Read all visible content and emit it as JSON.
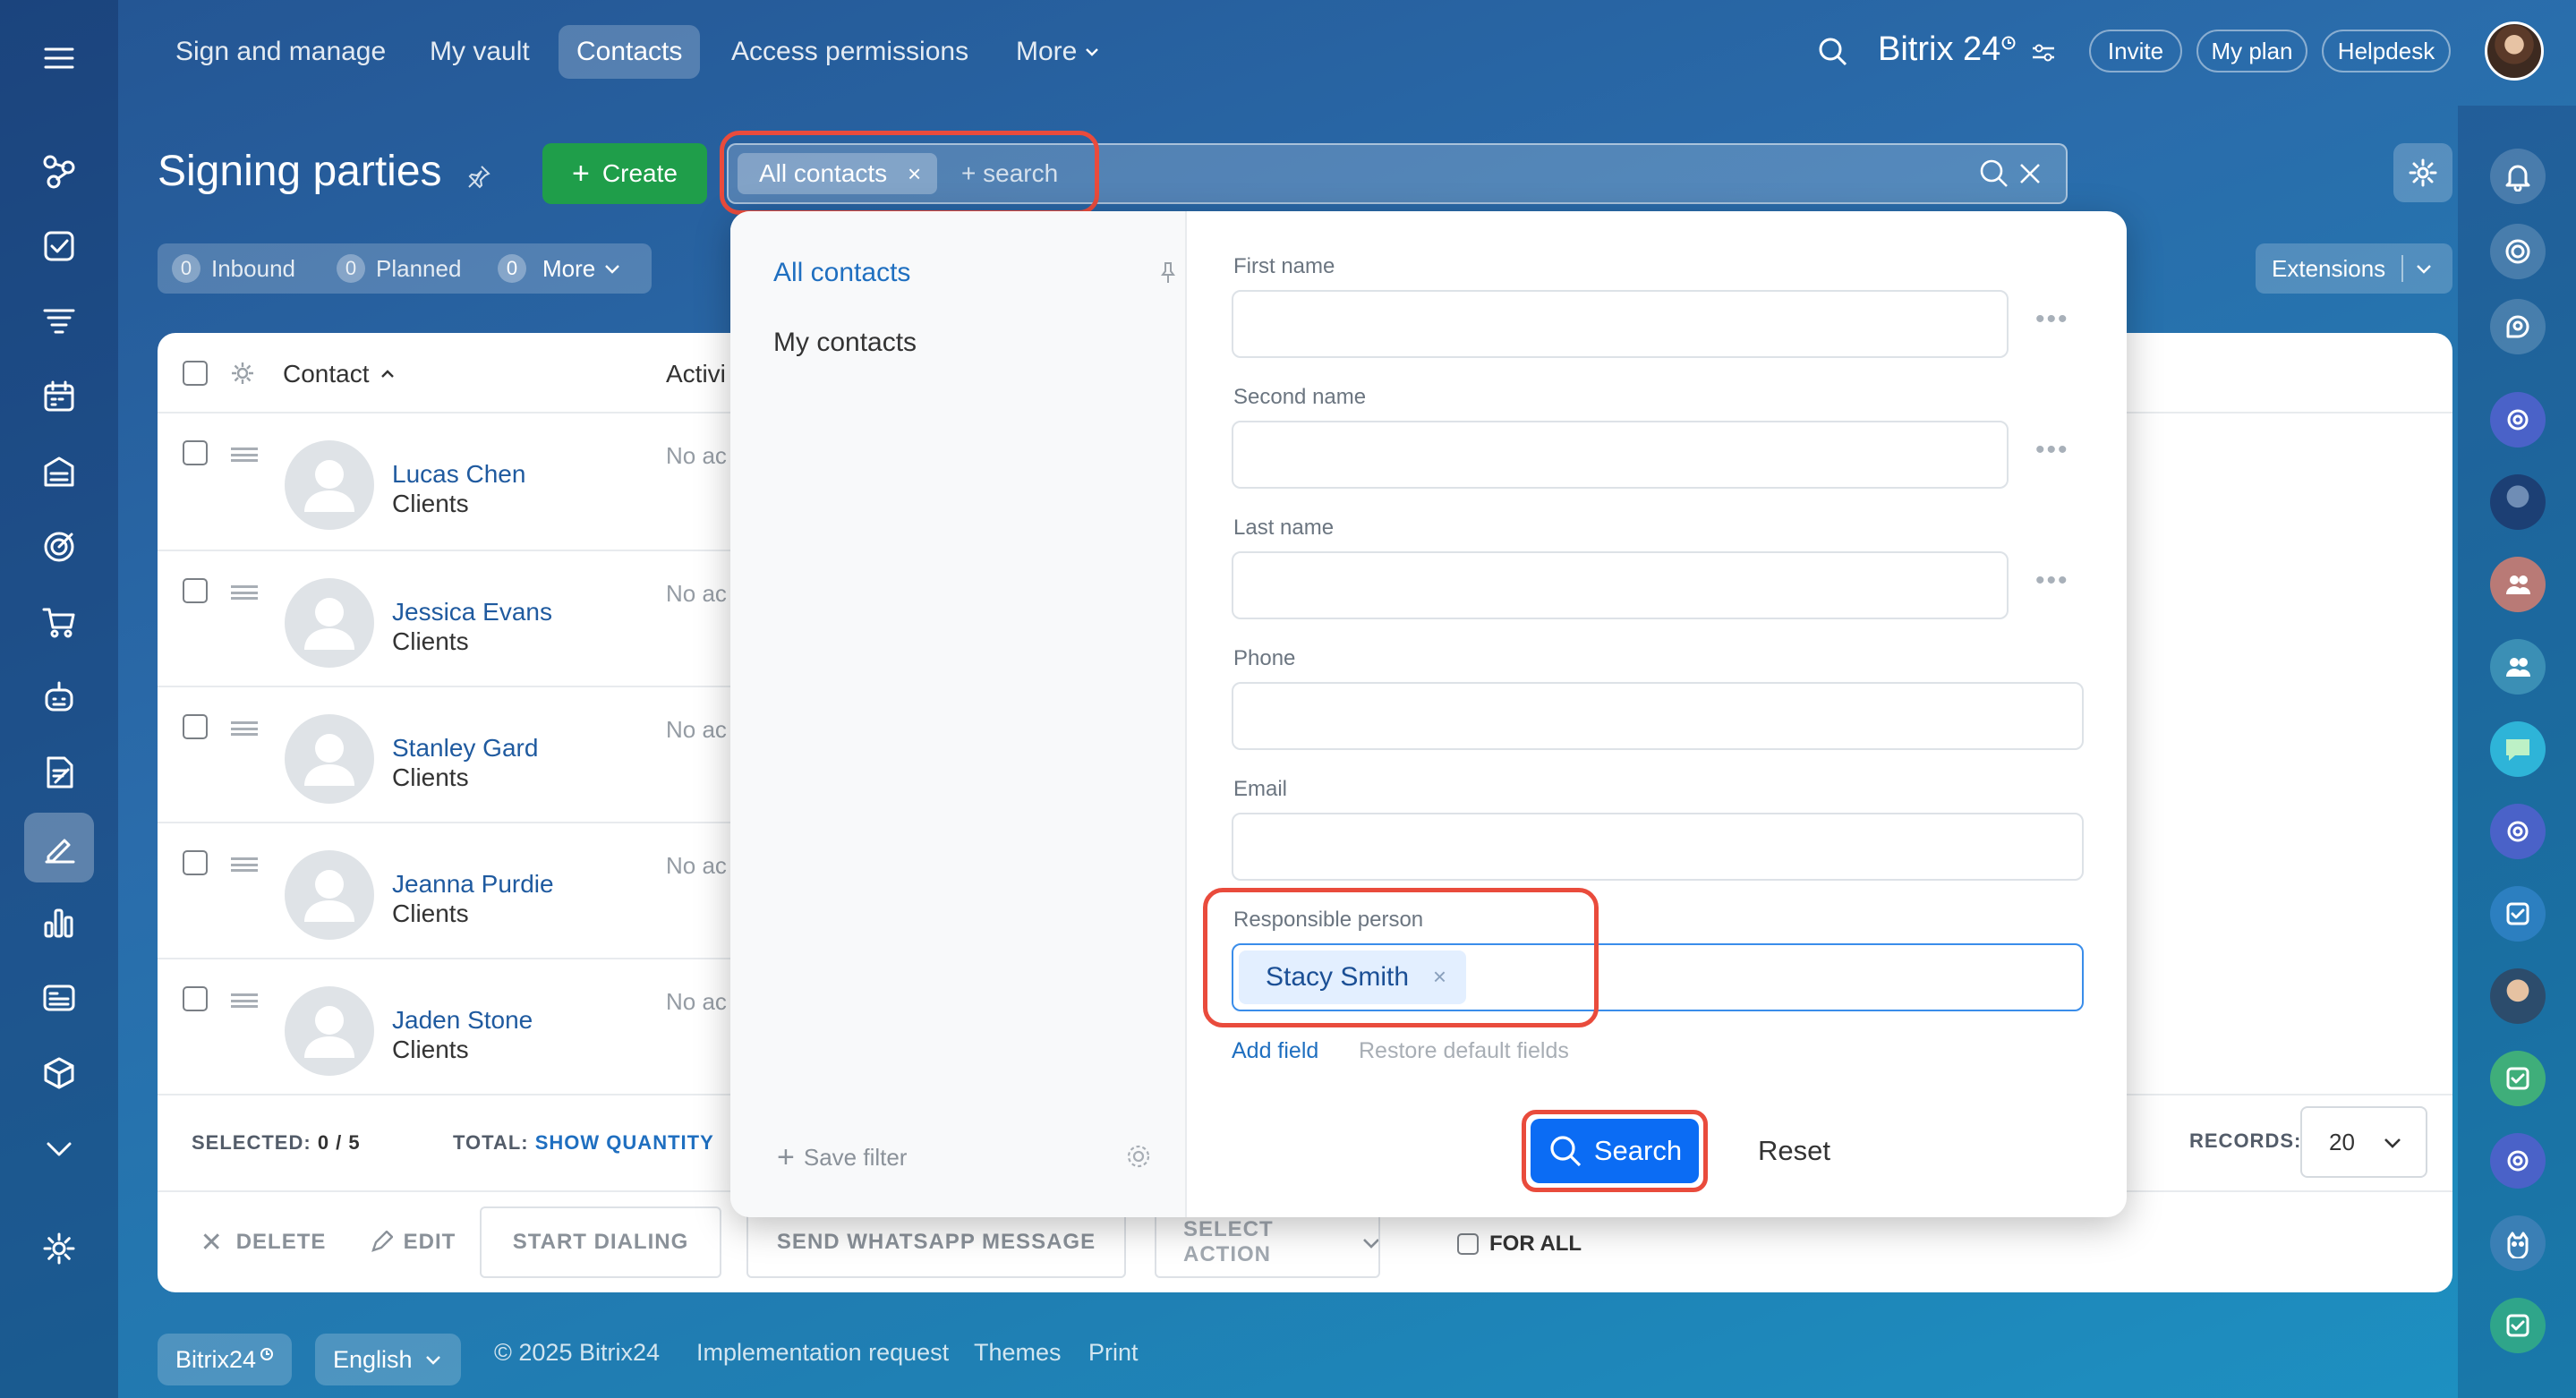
{
  "header": {
    "nav": [
      "Sign and manage",
      "My vault",
      "Contacts",
      "Access permissions",
      "More"
    ],
    "brand": "Bitrix 24",
    "invite": "Invite",
    "my_plan": "My plan",
    "helpdesk": "Helpdesk"
  },
  "toolbar": {
    "page_title": "Signing parties",
    "create_label": "Create",
    "filter_chip": "All contacts",
    "search_placeholder": "+ search",
    "extensions": "Extensions"
  },
  "counters": [
    {
      "count": "0",
      "label": "Inbound"
    },
    {
      "count": "0",
      "label": "Planned"
    },
    {
      "count": "0",
      "label": "More"
    }
  ],
  "grid": {
    "col_contact": "Contact",
    "col_activity": "Activi",
    "rows": [
      {
        "name": "Lucas Chen",
        "type": "Clients",
        "activity": "No ac"
      },
      {
        "name": "Jessica Evans",
        "type": "Clients",
        "activity": "No ac"
      },
      {
        "name": "Stanley Gard",
        "type": "Clients",
        "activity": "No ac"
      },
      {
        "name": "Jeanna Purdie",
        "type": "Clients",
        "activity": "No ac"
      },
      {
        "name": "Jaden Stone",
        "type": "Clients",
        "activity": "No ac"
      }
    ],
    "selected_label": "SELECTED:",
    "selected_value": "0 / 5",
    "total_label": "TOTAL:",
    "total_value": "SHOW QUANTITY",
    "records_label": "RECORDS:",
    "records_value": "20"
  },
  "actions": {
    "delete": "DELETE",
    "edit": "EDIT",
    "start_dialing": "START DIALING",
    "whatsapp": "SEND WHATSAPP MESSAGE",
    "select_action": "SELECT ACTION",
    "for_all": "FOR ALL"
  },
  "filter": {
    "presets": [
      "All contacts",
      "My contacts"
    ],
    "save_filter": "Save filter",
    "fields": [
      "First name",
      "Second name",
      "Last name",
      "Phone",
      "Email"
    ],
    "responsible_label": "Responsible person",
    "responsible_value": "Stacy Smith",
    "add_field": "Add field",
    "restore": "Restore default fields",
    "search_btn": "Search",
    "reset_btn": "Reset"
  },
  "footer": {
    "brand": "Bitrix24",
    "language": "English",
    "copyright": "© 2025 Bitrix24",
    "links": [
      "Implementation request",
      "Themes",
      "Print"
    ]
  },
  "colors": {
    "accent": "#0b6cf4",
    "create_green": "#1f9e4a",
    "highlight_red": "#e94b3c",
    "link": "#1f5a9f"
  }
}
